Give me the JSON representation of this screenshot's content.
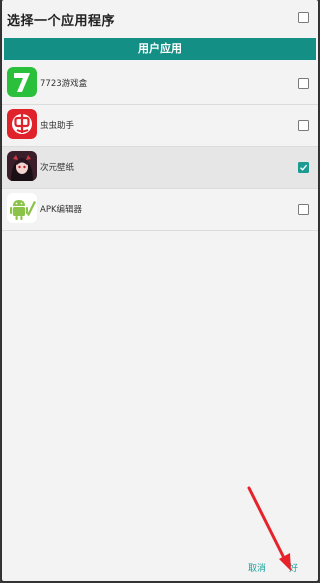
{
  "dialog": {
    "title": "选择一个应用程序",
    "section_header": "用户应用",
    "select_all_checked": false
  },
  "apps": [
    {
      "name": "7723游戏盒",
      "icon": "7723-game-box-icon",
      "checked": false
    },
    {
      "name": "虫虫助手",
      "icon": "chongchong-helper-icon",
      "checked": false
    },
    {
      "name": "次元壁纸",
      "icon": "anime-wallpaper-icon",
      "checked": true
    },
    {
      "name": "APK编辑器",
      "icon": "android-apk-editor-icon",
      "checked": false
    }
  ],
  "footer": {
    "cancel_label": "取消",
    "ok_label": "好"
  },
  "colors": {
    "accent": "#138f85",
    "check": "#1c9b92",
    "button_text": "#17a39a",
    "annotation_arrow": "#e8222a"
  }
}
